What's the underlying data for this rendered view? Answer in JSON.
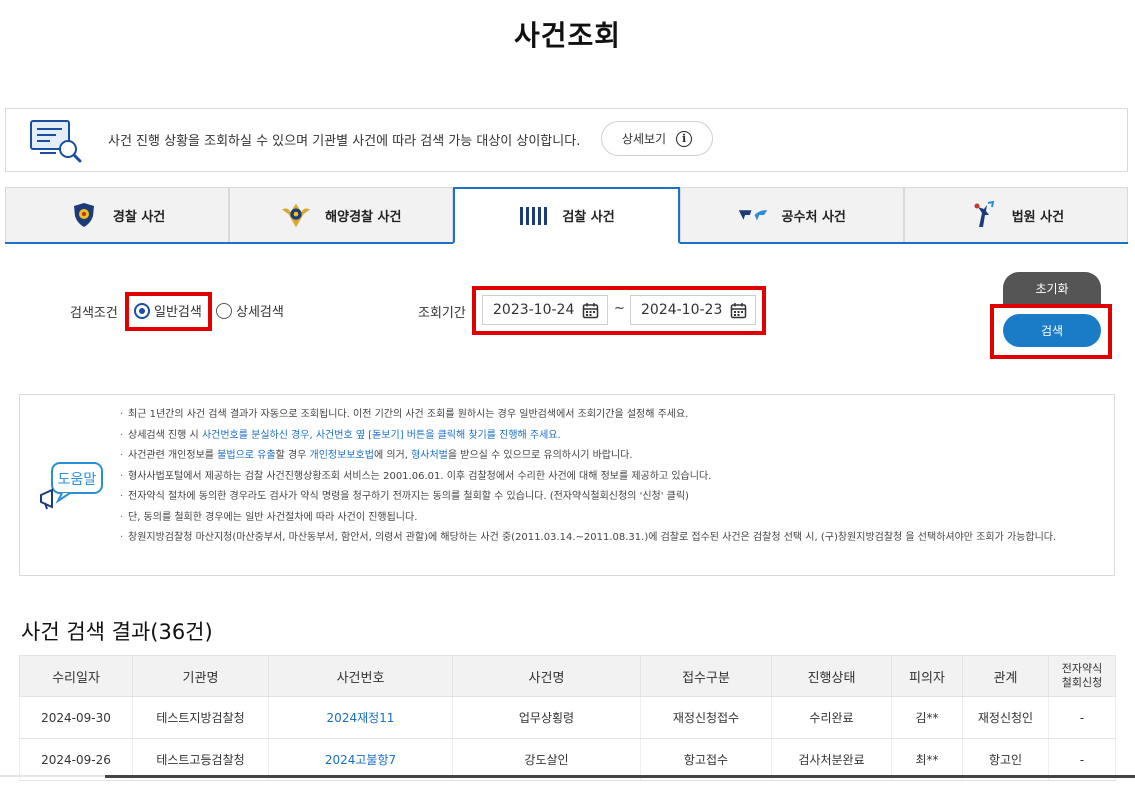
{
  "page": {
    "title": "사건조회"
  },
  "info": {
    "text": "사건 진행 상황을 조회하실 수 있으며 기관별 사건에 따라 검색 가능 대상이 상이합니다.",
    "detail_button": "상세보기",
    "detail_icon": "i"
  },
  "tabs": [
    {
      "label": "경찰 사건",
      "icon": "police-badge-icon"
    },
    {
      "label": "해양경찰 사건",
      "icon": "coast-guard-badge-icon"
    },
    {
      "label": "검찰 사건",
      "icon": "prosecution-pillars-icon",
      "active": true
    },
    {
      "label": "공수처 사건",
      "icon": "cio-wings-icon"
    },
    {
      "label": "법원 사건",
      "icon": "court-justice-icon"
    }
  ],
  "search": {
    "condition_label": "검색조건",
    "radio_general": "일반검색",
    "radio_detail": "상세검색",
    "selected": "일반검색",
    "period_label": "조회기간",
    "date_from": "2023-10-24",
    "date_to": "2024-10-23",
    "tilde": "~",
    "reset_button": "초기화",
    "search_button": "검색"
  },
  "help": {
    "icon_label": "도움말",
    "items": [
      {
        "parts": [
          {
            "t": "최근 1년간의 사건 검색 결과가 자동으로 조회됩니다. 이전 기간의 사건 조회를 원하시는 경우 일반검색에서 조회기간을 설정해 주세요."
          }
        ]
      },
      {
        "parts": [
          {
            "t": "상세검색 진행 시 "
          },
          {
            "t": "사건번호를 분실하신 경우, 사건번호 옆 [돋보기] 버튼을 클릭해 찾기를 진행해 주세요.",
            "link": true
          }
        ]
      },
      {
        "parts": [
          {
            "t": "사건관련 개인정보를 "
          },
          {
            "t": "불법으로 유출",
            "link": true
          },
          {
            "t": "할 경우 "
          },
          {
            "t": "개인정보보호법",
            "link": true
          },
          {
            "t": "에 의거, "
          },
          {
            "t": "형사처벌",
            "link": true
          },
          {
            "t": "을 받으실 수 있으므로 유의하시기 바랍니다."
          }
        ]
      },
      {
        "parts": [
          {
            "t": "형사사법포털에서 제공하는 검찰 사건진행상황조회 서비스는 2001.06.01. 이후 검찰청에서 수리한 사건에 대해 정보를 제공하고 있습니다."
          }
        ]
      },
      {
        "parts": [
          {
            "t": "전자약식 절차에 동의한 경우라도 검사가 약식 명령을 청구하기 전까지는 동의를 철회할 수 있습니다. (전자약식철회신청의 '신청' 클릭)"
          }
        ]
      },
      {
        "parts": [
          {
            "t": "단, 동의를 철회한 경우에는 일반 사건절차에 따라 사건이 진행됩니다."
          }
        ]
      },
      {
        "parts": [
          {
            "t": "창원지방검찰청 마산지청(마산중부서, 마산동부서, 함안서, 의령서 관할)에 해당하는 사건 중(2011.03.14.~2011.08.31.)에 검찰로 접수된 사건은 검찰청 선택 시, (구)창원지방검찰청 을 선택하셔야만 조회가 가능합니다."
          }
        ]
      }
    ]
  },
  "results": {
    "title": "사건 검색 결과(36건)",
    "columns": [
      "수리일자",
      "기관명",
      "사건번호",
      "사건명",
      "접수구분",
      "진행상태",
      "피의자",
      "관계",
      "전자약식\n철회신청"
    ],
    "rows": [
      [
        "2024-09-30",
        "테스트지방검찰청",
        "2024재정11",
        "업무상횡령",
        "재정신청접수",
        "수리완료",
        "김**",
        "재정신청인",
        "-"
      ],
      [
        "2024-09-26",
        "테스트고등검찰청",
        "2024고불항7",
        "강도살인",
        "항고접수",
        "검사처분완료",
        "최**",
        "항고인",
        "-"
      ]
    ]
  },
  "colors": {
    "accent": "#1a73c8",
    "search_button": "#1a7cc7",
    "reset_button": "#555555",
    "highlight": "#e00000",
    "link": "#1a6fc7"
  }
}
